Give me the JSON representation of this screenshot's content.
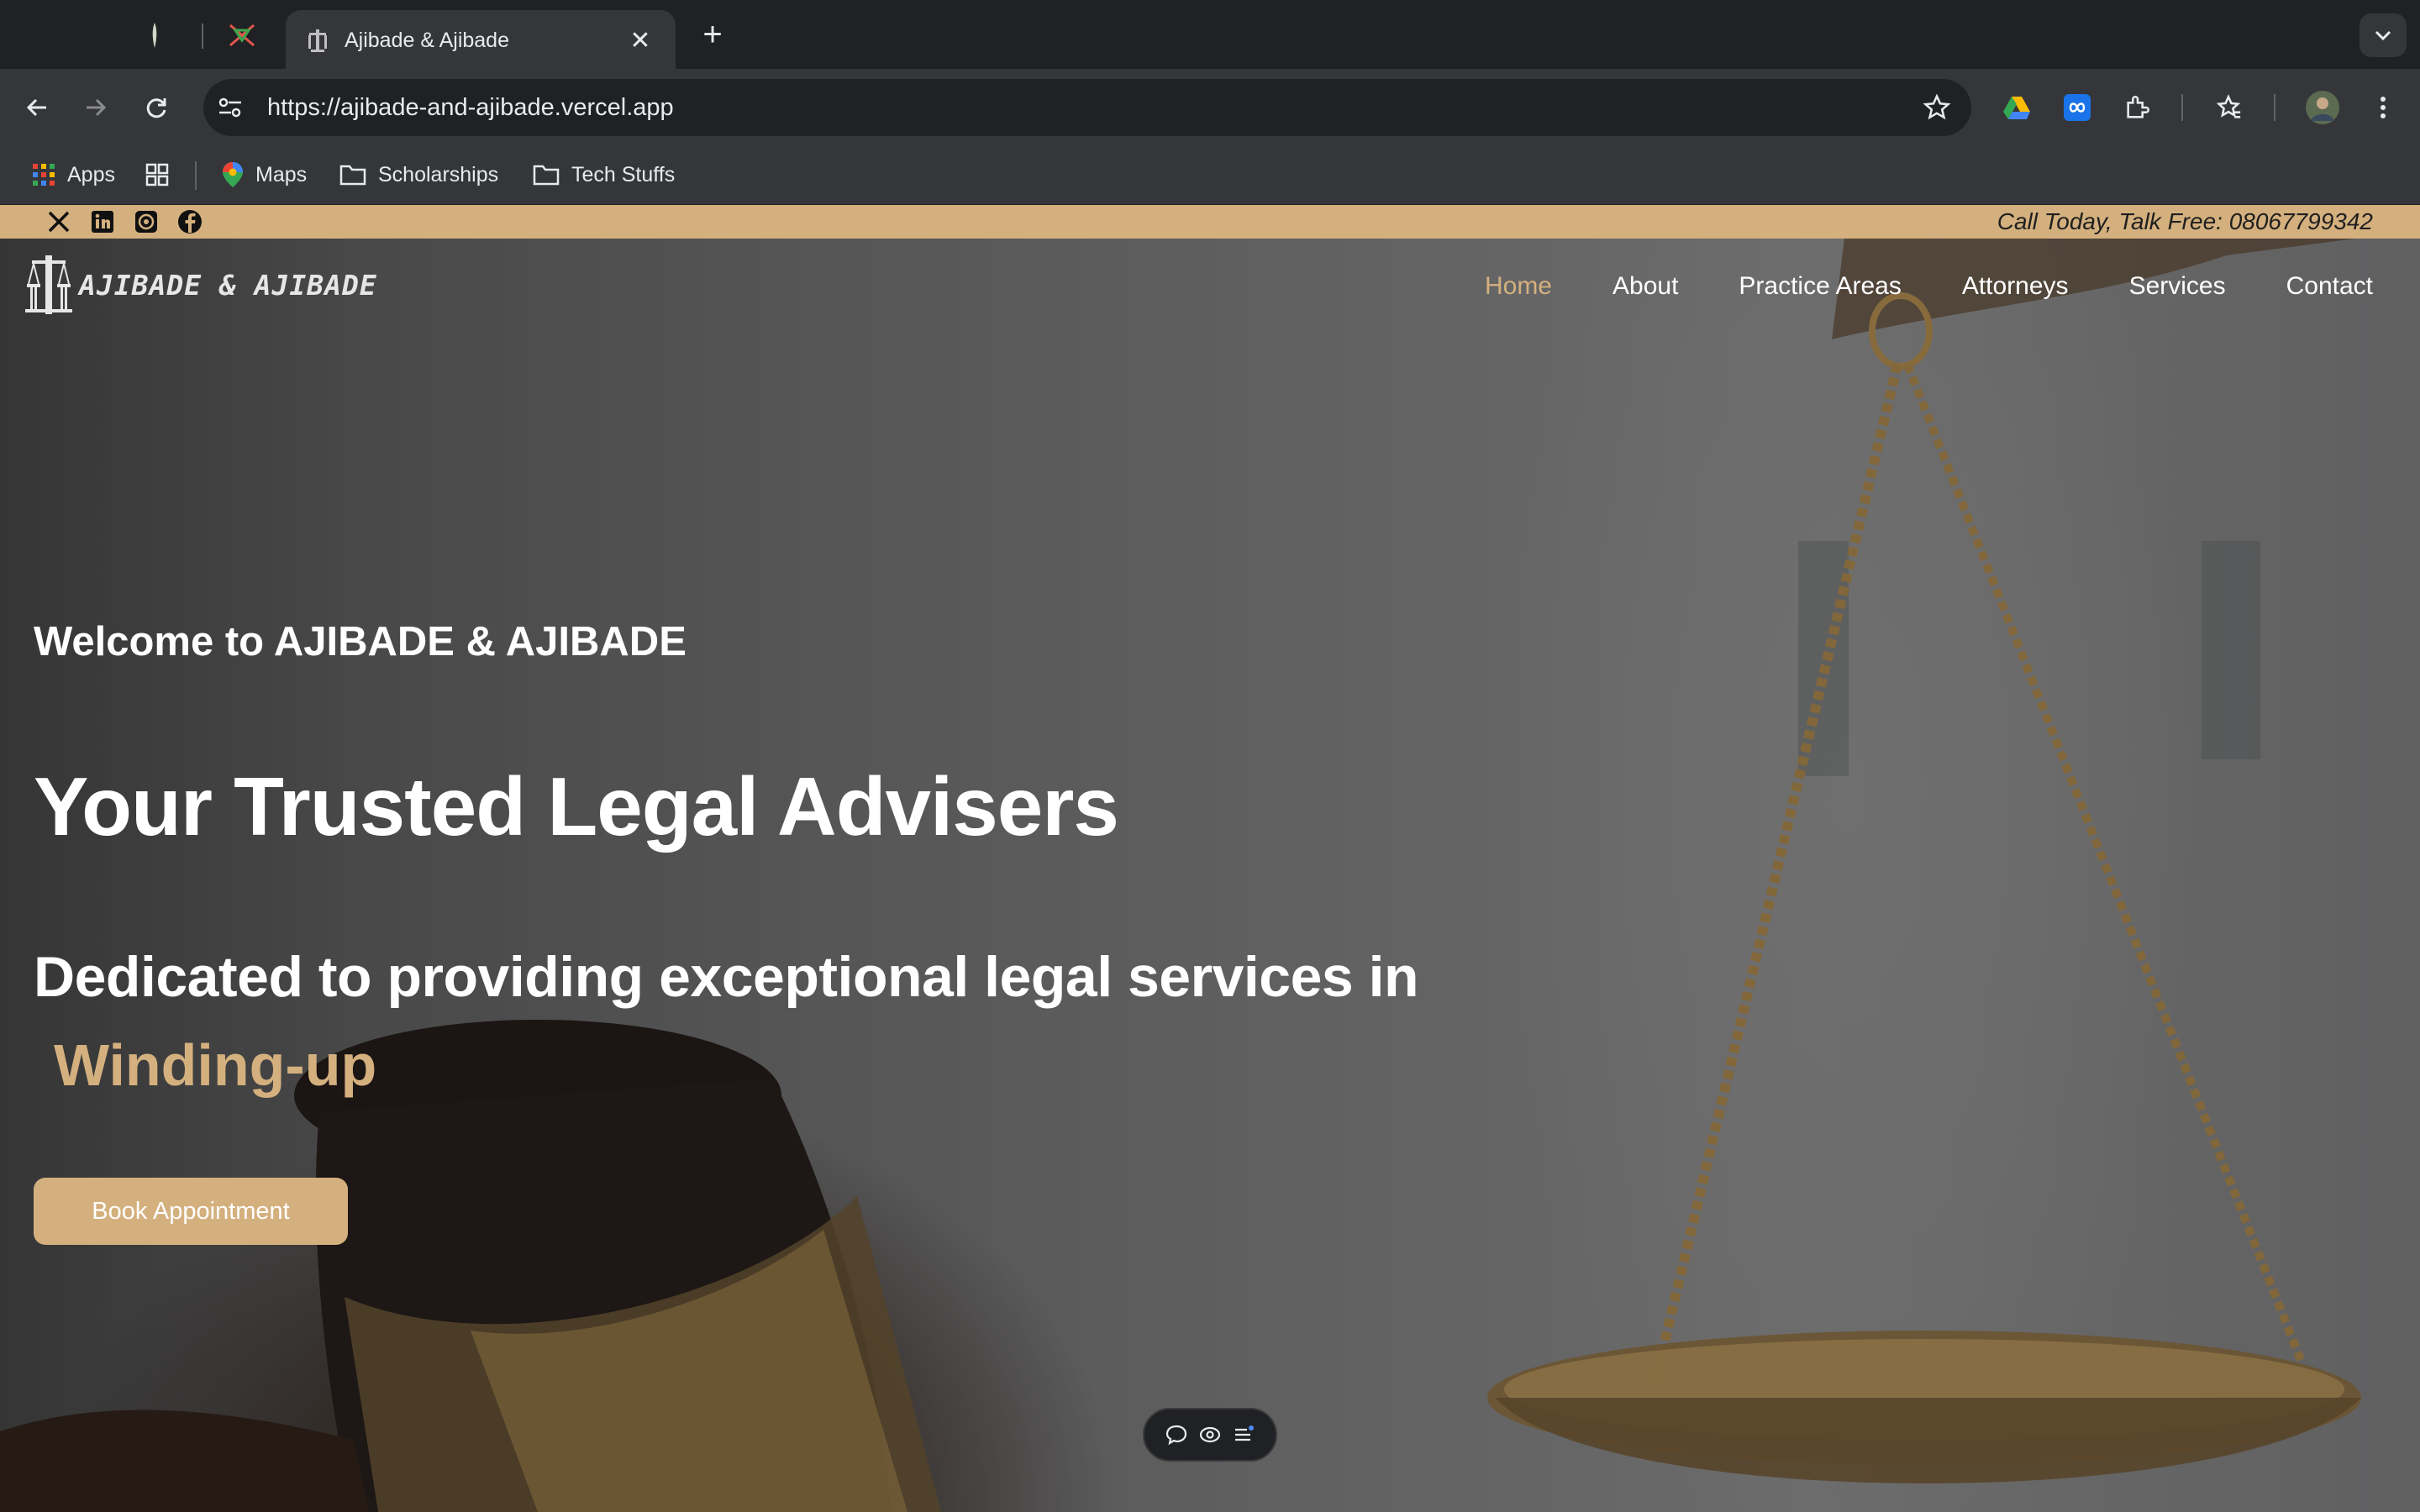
{
  "browser": {
    "active_tab_title": "Ajibade & Ajibade",
    "url": "https://ajibade-and-ajibade.vercel.app",
    "bookmarks": [
      {
        "label": "Apps",
        "icon": "apps-grid-icon"
      },
      {
        "label": "",
        "icon": "tab-groups-icon"
      },
      {
        "label": "Maps",
        "icon": "maps-pin-icon"
      },
      {
        "label": "Scholarships",
        "icon": "folder-icon"
      },
      {
        "label": "Tech Stuffs",
        "icon": "folder-icon"
      }
    ]
  },
  "site": {
    "topbar": {
      "call_text": "Call Today, Talk Free: 08067799342",
      "social_icons": [
        "x-icon",
        "linkedin-icon",
        "whatsapp-icon",
        "facebook-icon"
      ]
    },
    "logo_text": "AJIBADE & AJIBADE",
    "nav": [
      {
        "label": "Home",
        "active": true
      },
      {
        "label": "About",
        "active": false
      },
      {
        "label": "Practice Areas",
        "active": false
      },
      {
        "label": "Attorneys",
        "active": false
      },
      {
        "label": "Services",
        "active": false
      },
      {
        "label": "Contact",
        "active": false
      }
    ],
    "hero": {
      "welcome": "Welcome to AJIBADE & AJIBADE",
      "headline": "Your Trusted Legal Advisers",
      "subheadline": "Dedicated to providing exceptional legal services in",
      "rotating_word": "Winding-up",
      "cta_label": "Book Appointment"
    }
  },
  "colors": {
    "accent_gold": "#d4b07e",
    "chrome_dark": "#202124",
    "chrome_toolbar": "#35363a"
  }
}
